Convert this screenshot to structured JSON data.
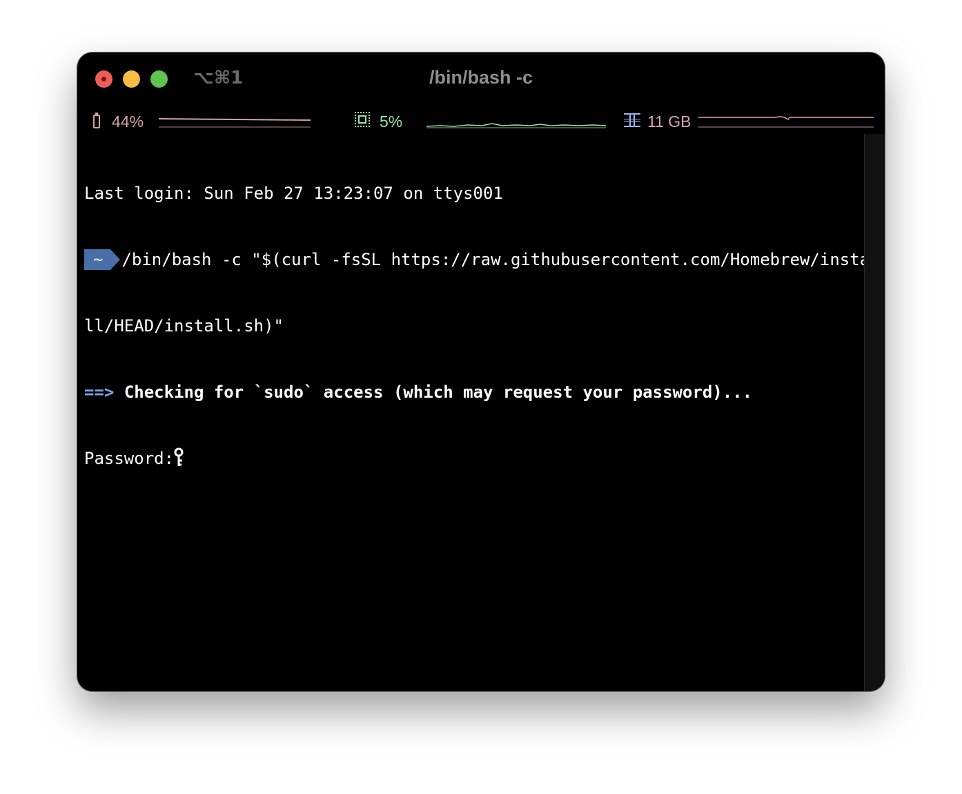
{
  "window": {
    "title": "/bin/bash -c",
    "shortcut": "⌥⌘1",
    "traffic_colors": {
      "close": "#ee5d57",
      "minimize": "#f5bd43",
      "maximize": "#5fc54d"
    }
  },
  "status": {
    "battery": {
      "value": "44%",
      "color": "#d4a2a2",
      "icon": "battery-icon"
    },
    "cpu": {
      "value": "5%",
      "color": "#9ce3a6",
      "icon": "cpu-chip-icon"
    },
    "memory": {
      "value": "11 GB",
      "color": "#d9a4c8",
      "icon": "memory-module-icon"
    }
  },
  "terminal": {
    "last_login": "Last login: Sun Feb 27 13:23:07 on ttys001",
    "prompt_dir": "~",
    "command_line1": "/bin/bash -c \"$(curl -fsSL https://raw.githubusercontent.com/Homebrew/insta",
    "command_line2": "ll/HEAD/install.sh)\"",
    "info_arrow": "==>",
    "info_text": "Checking for `sudo` access (which may request your password)...",
    "password_prompt": "Password:",
    "prompt_color": "#4a6fa8",
    "arrow_color": "#7fa6e8"
  }
}
